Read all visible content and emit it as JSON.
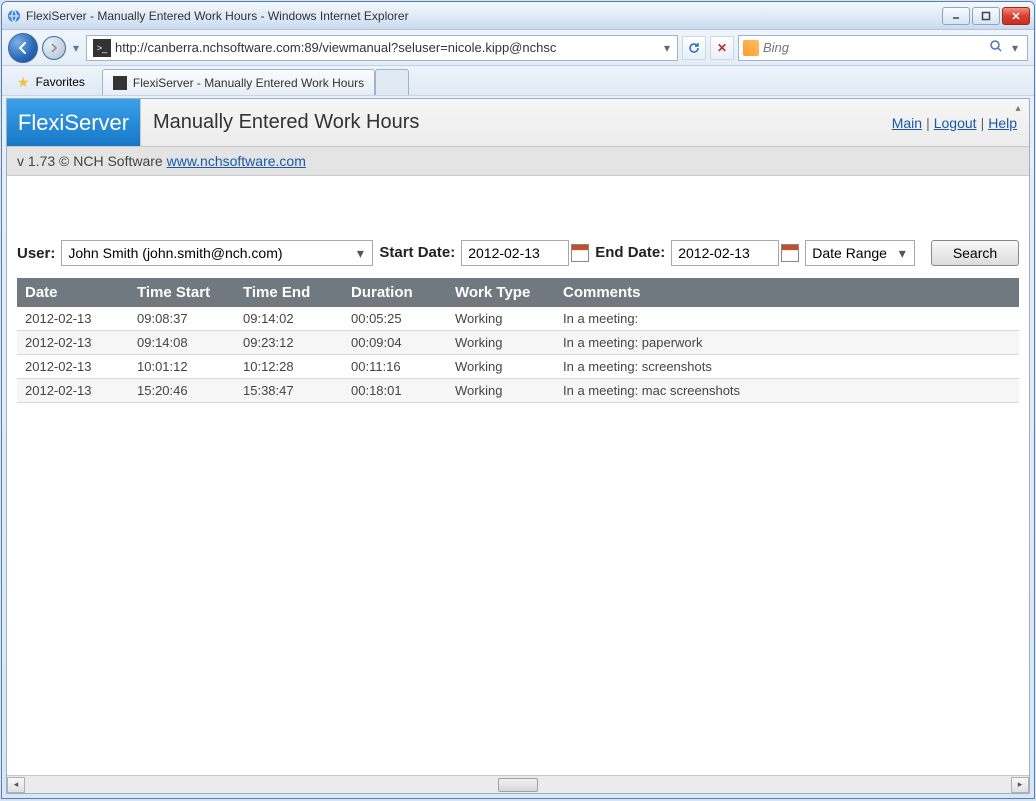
{
  "window": {
    "title": "FlexiServer - Manually Entered Work Hours - Windows Internet Explorer"
  },
  "nav": {
    "url": "http://canberra.nchsoftware.com:89/viewmanual?seluser=nicole.kipp@nchsc",
    "search_placeholder": "Bing"
  },
  "favorites": {
    "label": "Favorites",
    "active_tab": "FlexiServer - Manually Entered Work Hours"
  },
  "app": {
    "logo": "FlexiServer",
    "page_title": "Manually Entered Work Hours",
    "links": {
      "main": "Main",
      "logout": "Logout",
      "help": "Help"
    },
    "version_prefix": "v 1.73 © NCH Software ",
    "version_link": "www.nchsoftware.com"
  },
  "filters": {
    "user_label": "User:",
    "user_value": "John Smith (john.smith@nch.com)",
    "start_label": "Start Date:",
    "start_value": "2012-02-13",
    "end_label": "End Date:",
    "end_value": "2012-02-13",
    "range_value": "Date Range",
    "search_label": "Search"
  },
  "table": {
    "headers": [
      "Date",
      "Time Start",
      "Time End",
      "Duration",
      "Work Type",
      "Comments"
    ],
    "rows": [
      [
        "2012-02-13",
        "09:08:37",
        "09:14:02",
        "00:05:25",
        "Working",
        "In a meeting:"
      ],
      [
        "2012-02-13",
        "09:14:08",
        "09:23:12",
        "00:09:04",
        "Working",
        "In a meeting: paperwork"
      ],
      [
        "2012-02-13",
        "10:01:12",
        "10:12:28",
        "00:11:16",
        "Working",
        "In a meeting: screenshots"
      ],
      [
        "2012-02-13",
        "15:20:46",
        "15:38:47",
        "00:18:01",
        "Working",
        "In a meeting: mac screenshots"
      ]
    ]
  }
}
